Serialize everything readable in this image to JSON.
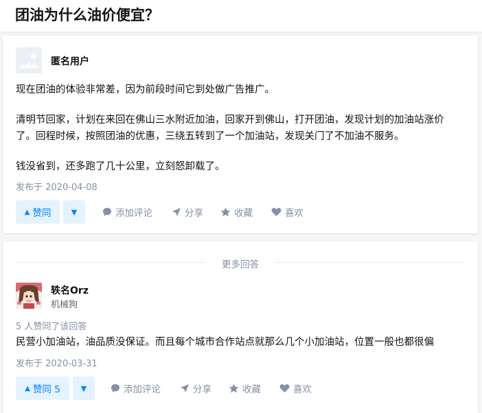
{
  "page": {
    "title": "团油为什么油价便宜？"
  },
  "answer1": {
    "author_name": "匿名用户",
    "paragraphs": [
      [
        "现在团油的体验非常差，因为前段时间它到处做广告推广。"
      ],
      [
        "清明节回家，计划在来回在佛山三水附近加油，回家开到佛山，打开团油，发现计划的加油站涨价",
        "了。回程时候，按照团油的优惠，三绕五转到了一个加油站，发现关门了不加油不服务。"
      ],
      [
        "钱没省到，还多跑了几十公里，立刻怒卸载了。"
      ]
    ],
    "published": "发布于 2020-04-08",
    "vote_up_label": "赞同",
    "actions": {
      "comment": "添加评论",
      "share": "分享",
      "favorite": "收藏",
      "like": "喜欢"
    }
  },
  "divider": {
    "more_answers": "更多回答"
  },
  "answer2": {
    "author_name": "轶名Orz",
    "author_bio": "机械狗",
    "voters": "5 人赞同了该回答",
    "content": "民营小加油站，油品质没保证。而且每个城市合作站点就那么几个小加油站，位置一般也都很偏",
    "published": "发布于 2020-03-31",
    "vote_up_label": "赞同 5",
    "actions": {
      "comment": "添加评论",
      "share": "分享",
      "favorite": "收藏",
      "like": "喜欢"
    }
  },
  "colors": {
    "accent": "#0084ff",
    "accent_bg": "#e5f2ff",
    "meta": "#8590a6"
  }
}
